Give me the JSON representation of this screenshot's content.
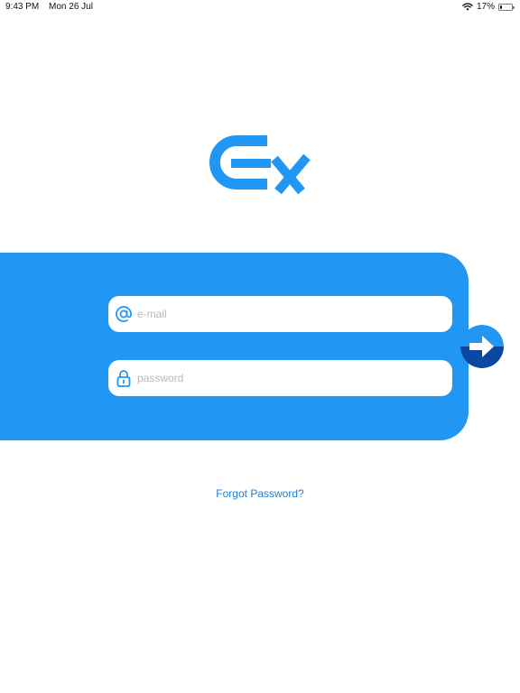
{
  "status_bar": {
    "time": "9:43 PM",
    "date": "Mon 26 Jul",
    "battery_percent_label": "17%",
    "battery_level": 0.17,
    "wifi_icon": "wifi-icon"
  },
  "brand": {
    "logo_icon": "ex-logo-icon",
    "accent_color": "#2196f3",
    "dark_accent_color": "#0d47a1"
  },
  "login_form": {
    "email": {
      "icon": "at-sign-icon",
      "placeholder": "e-mail",
      "value": ""
    },
    "password": {
      "icon": "lock-icon",
      "placeholder": "password",
      "value": ""
    },
    "submit_icon": "arrow-right-icon"
  },
  "forgot_password": {
    "label": "Forgot Password?",
    "color": "#1e7bd6"
  }
}
